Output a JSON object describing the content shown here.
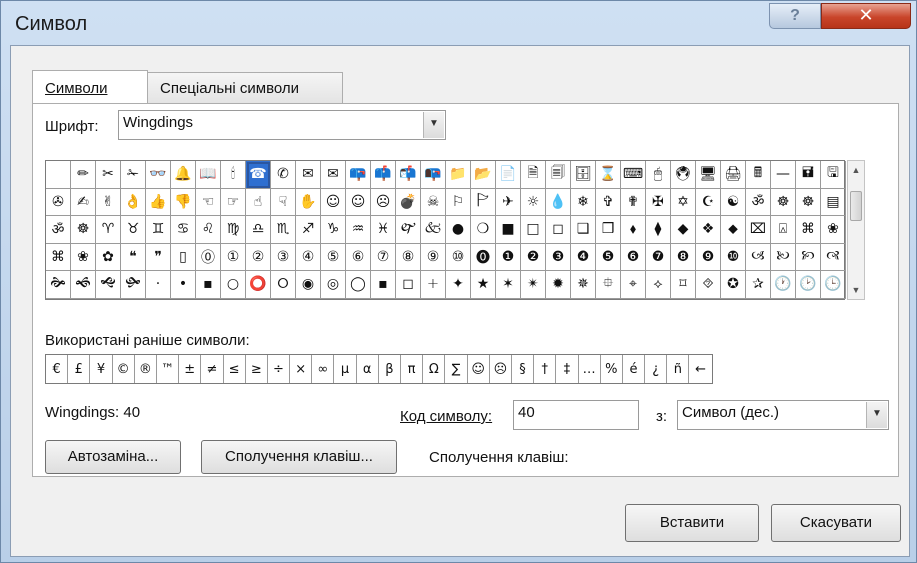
{
  "window": {
    "title": "Символ",
    "help_label": "?",
    "close_label": "✕"
  },
  "tabs": [
    {
      "label": "Символи",
      "active": true
    },
    {
      "label": "Спеціальні символи",
      "active": false
    }
  ],
  "font": {
    "label": "Шрифт:",
    "value": "Wingdings"
  },
  "symbol_grid": {
    "selected_index": 8,
    "rows": [
      [
        " ",
        "✏",
        "✂",
        "✁",
        "👓",
        "🔔",
        "📖",
        "🕯",
        "☎",
        "✆",
        "✉",
        "✉",
        "📪",
        "📫",
        "📬",
        "📭",
        "📁",
        "📂",
        "📄",
        "🗎",
        "🗐",
        "🗄",
        "⌛",
        "⌨",
        "🖱",
        "🖲",
        "🖥",
        "🖨",
        "🖩",
        "—",
        "🖬",
        "🖫"
      ],
      [
        "✇",
        "✍",
        "✌",
        "👌",
        "👍",
        "👎",
        "☜",
        "☞",
        "☝",
        "☟",
        "✋",
        "☺",
        "☺",
        "☹",
        "💣",
        "☠",
        "⚐",
        "🏱",
        "✈",
        "☼",
        "💧",
        "❄",
        "✞",
        "✟",
        "✠",
        "✡",
        "☪",
        "☯",
        "ॐ",
        "☸",
        "☸",
        "▤"
      ],
      [
        "ॐ",
        "☸",
        "♈",
        "♉",
        "♊",
        "♋",
        "♌",
        "♍",
        "♎",
        "♏",
        "♐",
        "♑",
        "♒",
        "♓",
        "🙰",
        "🙵",
        "●",
        "❍",
        "■",
        "□",
        "◻",
        "❑",
        "❒",
        "⬧",
        "⧫",
        "◆",
        "❖",
        "⬥",
        "⌧",
        "⍓",
        "⌘",
        "❀"
      ],
      [
        "⌘",
        "❀",
        "✿",
        "❝",
        "❞",
        "▯",
        "⓪",
        "①",
        "②",
        "③",
        "④",
        "⑤",
        "⑥",
        "⑦",
        "⑧",
        "⑨",
        "⑩",
        "⓿",
        "❶",
        "❷",
        "❸",
        "❹",
        "❺",
        "❻",
        "❼",
        "❽",
        "❾",
        "❿",
        "🙢",
        "🙠",
        "🙡",
        "🙣"
      ],
      [
        "🙞",
        "🙜",
        "🙝",
        "🙟",
        "·",
        "•",
        "▪",
        "○",
        "⭕",
        "⭘",
        "◉",
        "◎",
        "◯",
        "▪",
        "◻",
        "🞢",
        "✦",
        "★",
        "✶",
        "✴",
        "✹",
        "✵",
        "⯐",
        "⌖",
        "⟡",
        "⌑",
        "⯑",
        "✪",
        "✰",
        "🕐",
        "🕑",
        "🕒"
      ]
    ]
  },
  "recent": {
    "label": "Використані раніше символи:",
    "symbols": [
      "€",
      "£",
      "¥",
      "©",
      "®",
      "™",
      "±",
      "≠",
      "≤",
      "≥",
      "÷",
      "×",
      "∞",
      "µ",
      "α",
      "β",
      "π",
      "Ω",
      "∑",
      "☺",
      "☹",
      "§",
      "†",
      "‡",
      "…",
      "%",
      "é",
      "¿",
      "ñ",
      "←"
    ]
  },
  "info": {
    "font_code_text": "Wingdings: 40",
    "code_label": "Код символу:",
    "code_value": "40",
    "from_label": "з:",
    "from_value": "Символ (дес.)",
    "shortcut_label": "Сполучення клавіш:"
  },
  "buttons": {
    "autocorrect": "Автозаміна...",
    "shortcut_key": "Сполучення клавіш...",
    "insert": "Вставити",
    "cancel": "Скасувати"
  }
}
